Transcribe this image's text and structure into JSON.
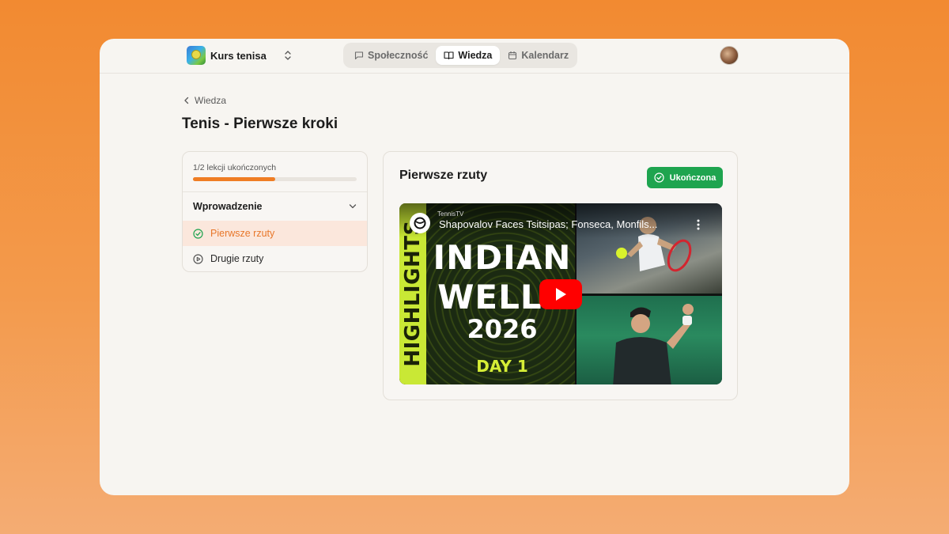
{
  "app": {
    "space_name": "Kurs tenisa",
    "colors": {
      "accent": "#ef7d24",
      "success": "#1ea44f",
      "background_gradient": [
        "#f28a31",
        "#f4ac73"
      ]
    }
  },
  "nav": {
    "tabs": [
      {
        "label": "Społeczność",
        "icon": "message-square-icon",
        "active": false
      },
      {
        "label": "Wiedza",
        "icon": "book-open-icon",
        "active": true
      },
      {
        "label": "Kalendarz",
        "icon": "calendar-icon",
        "active": false
      }
    ]
  },
  "breadcrumb": {
    "label": "Wiedza"
  },
  "page": {
    "title": "Tenis - Pierwsze kroki"
  },
  "sidebar": {
    "progress_text": "1/2 lekcji ukończonych",
    "progress_fraction": 0.5,
    "section": {
      "label": "Wprowadzenie",
      "expanded": true
    },
    "lessons": [
      {
        "label": "Pierwsze rzuty",
        "status": "completed",
        "icon": "check-circle-icon",
        "active": true
      },
      {
        "label": "Drugie rzuty",
        "status": "not-started",
        "icon": "play-circle-icon",
        "active": false
      }
    ]
  },
  "lesson": {
    "title": "Pierwsze rzuty",
    "complete_label": "Ukończona",
    "video": {
      "channel": "TennisTV",
      "title": "Shapovalov Faces Tsitsipas; Fonseca, Monfils...",
      "thumbnail_text": {
        "side": "HIGHLIGHTS",
        "line1": "INDIAN",
        "line2": "WELLS",
        "year": "2026",
        "day": "DAY 1"
      }
    }
  }
}
